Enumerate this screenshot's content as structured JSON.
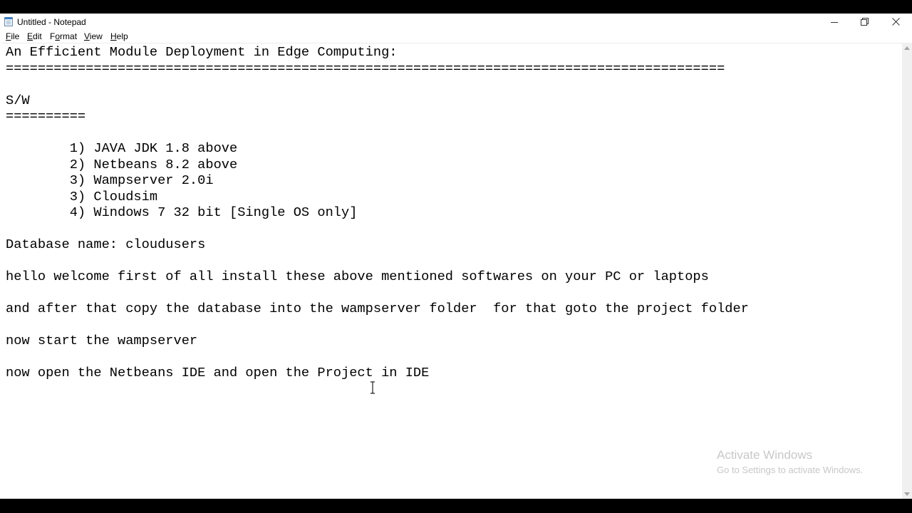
{
  "window": {
    "title": "Untitled - Notepad",
    "icons": {
      "app": "notepad-icon",
      "minimize": "minimize-icon",
      "maximize": "restore-icon",
      "close": "close-icon"
    }
  },
  "menu": [
    {
      "label_acc": "F",
      "label_rest": "ile"
    },
    {
      "label_acc": "E",
      "label_rest": "dit"
    },
    {
      "label_pre": "F",
      "label_acc": "o",
      "label_rest": "rmat"
    },
    {
      "label_acc": "V",
      "label_rest": "iew"
    },
    {
      "label_acc": "H",
      "label_rest": "elp"
    }
  ],
  "document": {
    "lines": [
      "An Efficient Module Deployment in Edge Computing:",
      "==========================================================================================",
      "",
      "S/W",
      "==========",
      "",
      "        1) JAVA JDK 1.8 above",
      "        2) Netbeans 8.2 above",
      "        3) Wampserver 2.0i",
      "        3) Cloudsim",
      "        4) Windows 7 32 bit [Single OS only]",
      "",
      "Database name: cloudusers",
      "",
      "hello welcome first of all install these above mentioned softwares on your PC or laptops",
      "",
      "and after that copy the database into the wampserver folder  for that goto the project folder",
      "",
      "now start the wampserver",
      "",
      "now open the Netbeans IDE and open the Project in IDE"
    ]
  },
  "watermark": {
    "title": "Activate Windows",
    "subtitle": "Go to Settings to activate Windows."
  },
  "colors": {
    "watermark": "#c8c8c8",
    "background": "#ffffff",
    "text": "#000000"
  }
}
